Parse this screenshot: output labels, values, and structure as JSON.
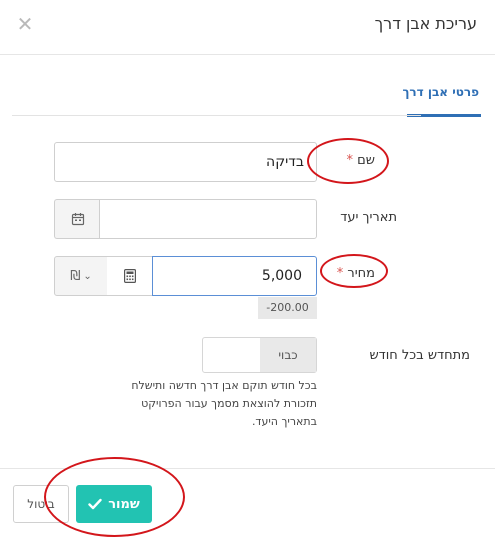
{
  "header": {
    "title": "עריכת אבן דרך",
    "close_icon": "close-icon"
  },
  "tabs": [
    {
      "label": "פרטי אבן דרך",
      "active": true
    }
  ],
  "form": {
    "name": {
      "label": "שם",
      "required_mark": "*",
      "value": "בדיקה"
    },
    "due_date": {
      "label": "תאריך יעד",
      "value": "",
      "icon": "calendar-icon"
    },
    "price": {
      "label": "מחיר",
      "required_mark": "*",
      "value": "5,000",
      "calculator_icon": "calculator-icon",
      "currency": "₪",
      "currency_chevron": "chevron-down-icon",
      "hint": "-200.00"
    },
    "monthly_renewal": {
      "label": "מתחדש בכל חודש",
      "toggle_label": "כבוי",
      "help_lines": [
        "בכל חודש תוקם אבן דרך חדשה ותישלח",
        "תזכורת להוצאת מסמך עבור הפרויקט",
        "בתאריך היעד."
      ]
    }
  },
  "footer": {
    "save_label": "שמור",
    "save_icon": "check-icon",
    "cancel_label": "ביטול"
  },
  "colors": {
    "accent": "#22c3b2",
    "tab_active": "#2f6fb5",
    "required": "#d9534f",
    "annotation": "#d3161b"
  }
}
